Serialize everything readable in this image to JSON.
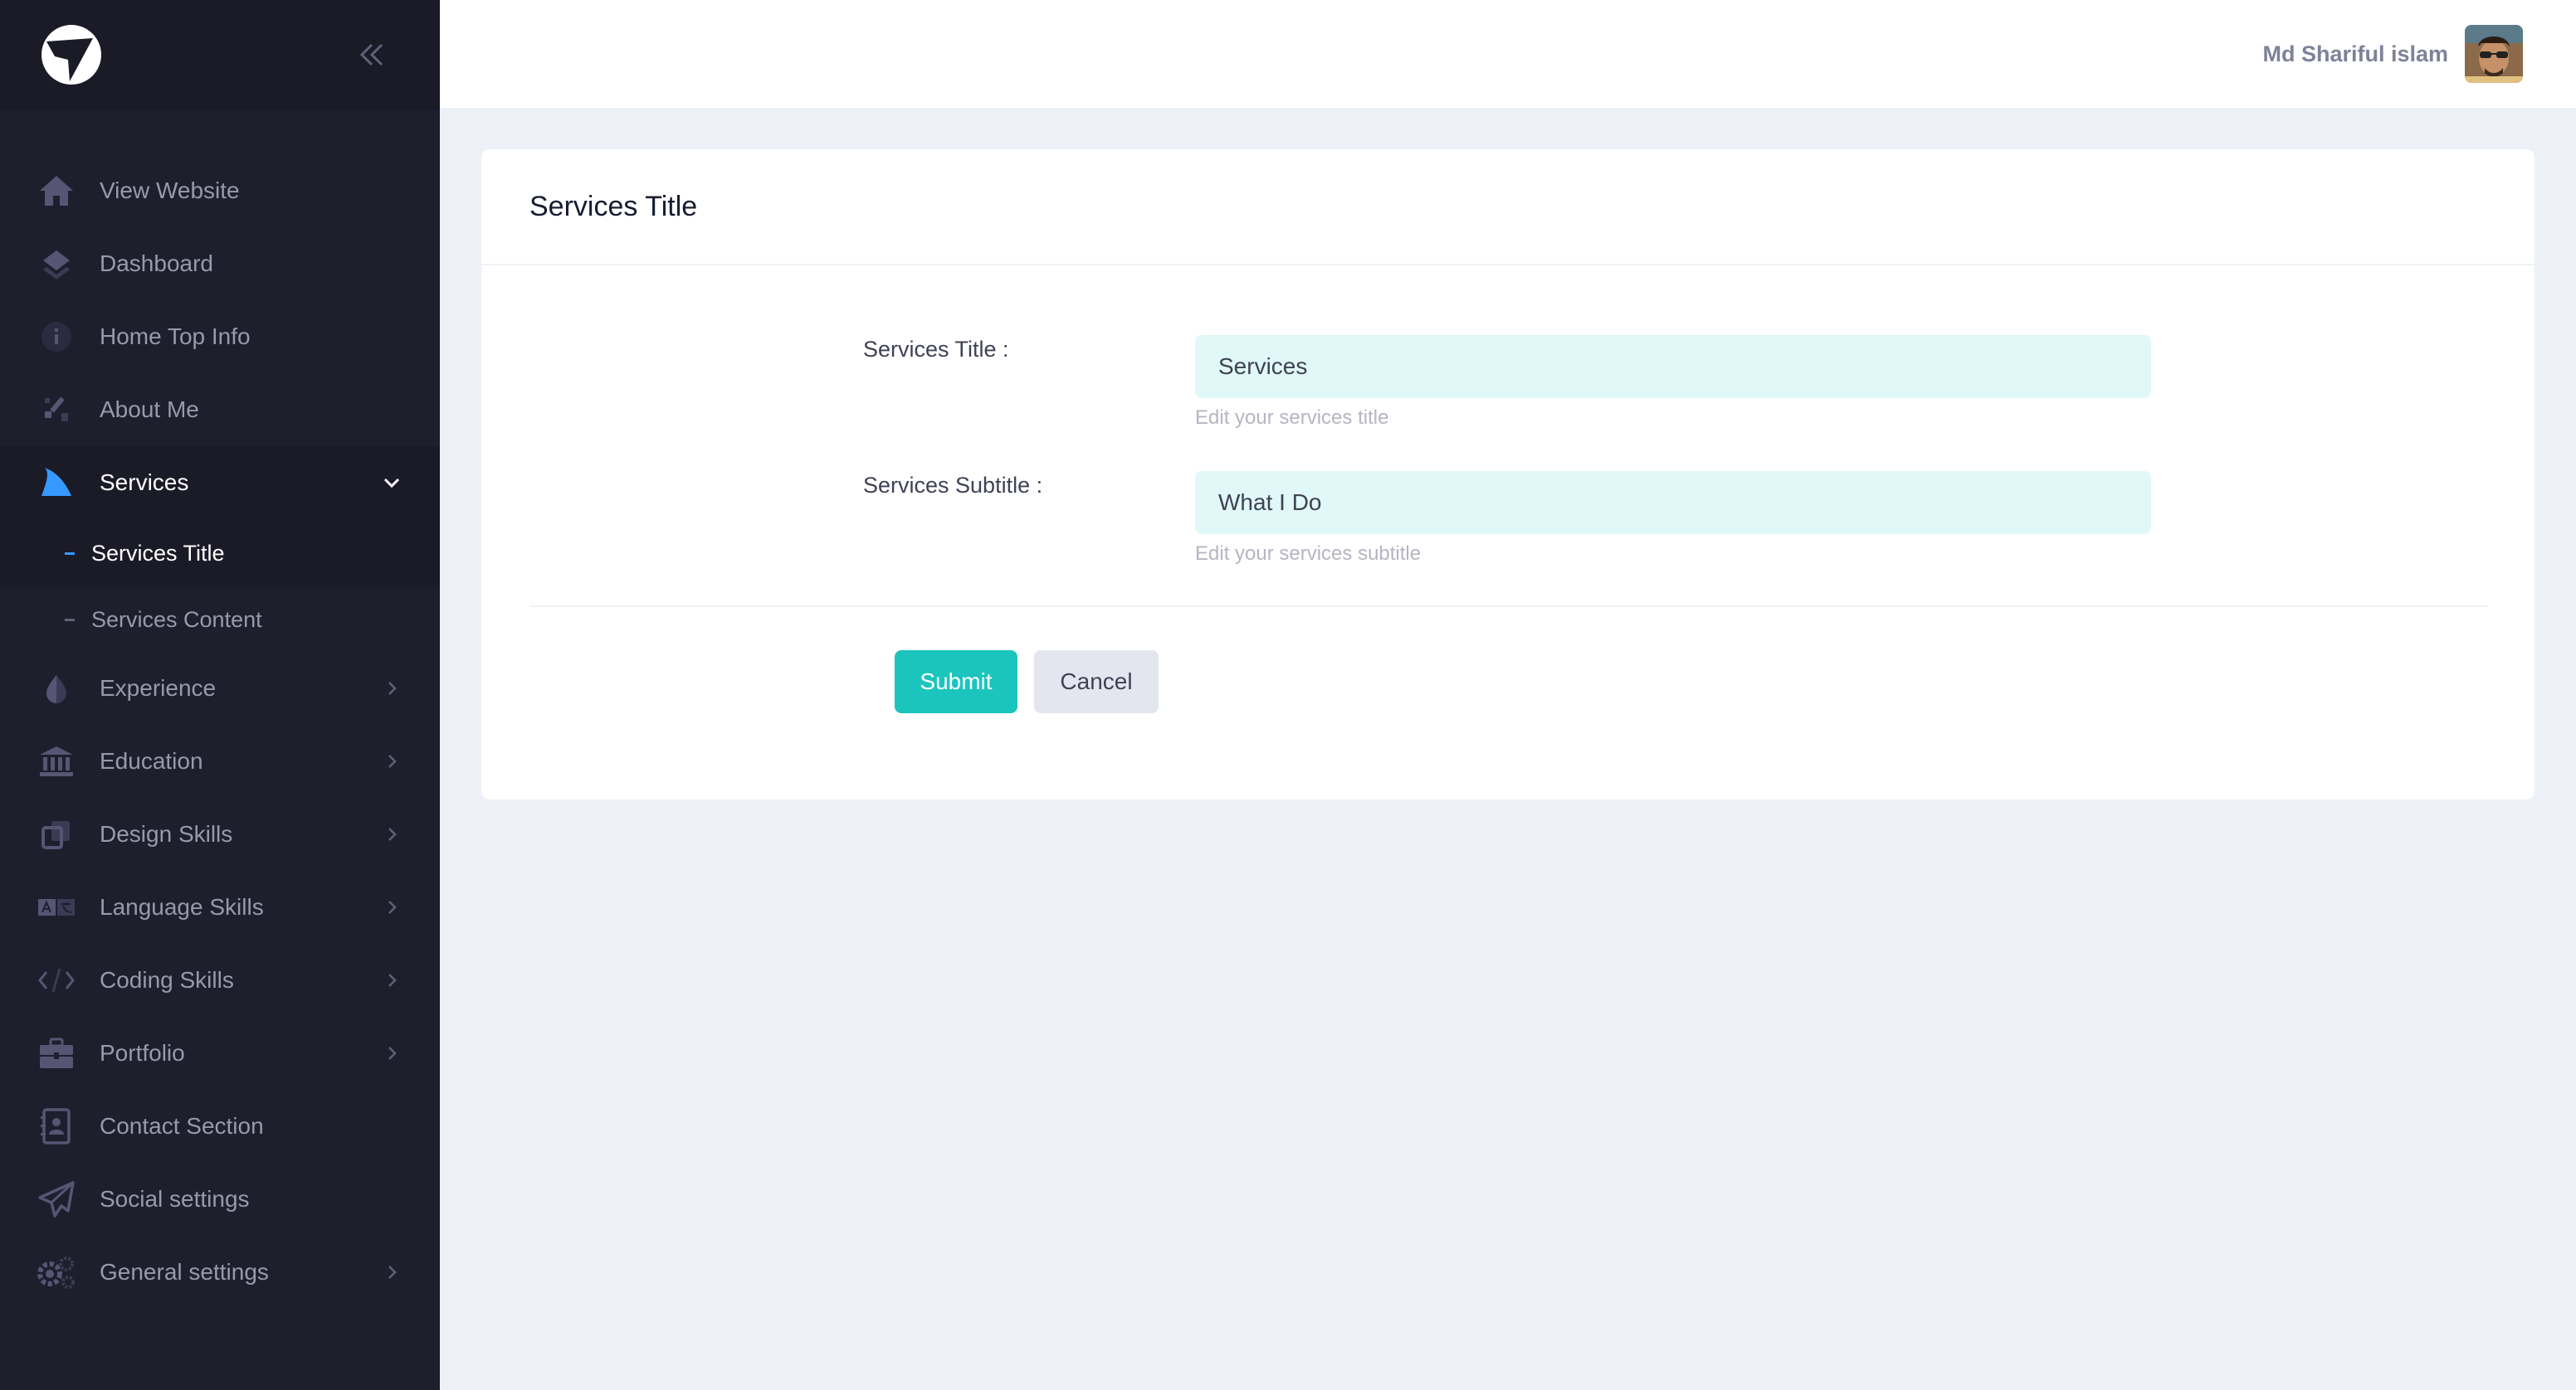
{
  "header": {
    "user_name": "Md Shariful islam"
  },
  "sidebar": {
    "items": [
      {
        "label": "View Website",
        "icon": "home-icon"
      },
      {
        "label": "Dashboard",
        "icon": "layers-icon"
      },
      {
        "label": "Home Top Info",
        "icon": "info-icon"
      },
      {
        "label": "About Me",
        "icon": "tools-icon"
      },
      {
        "label": "Services",
        "icon": "shark-fin-icon",
        "expanded": true
      },
      {
        "label": "Experience",
        "icon": "drop-half-icon"
      },
      {
        "label": "Education",
        "icon": "bank-icon"
      },
      {
        "label": "Design Skills",
        "icon": "copy-icon"
      },
      {
        "label": "Language Skills",
        "icon": "translate-icon"
      },
      {
        "label": "Coding Skills",
        "icon": "code-icon"
      },
      {
        "label": "Portfolio",
        "icon": "briefcase-icon"
      },
      {
        "label": "Contact Section",
        "icon": "contact-book-icon"
      },
      {
        "label": "Social settings",
        "icon": "send-icon"
      },
      {
        "label": "General settings",
        "icon": "gears-icon"
      }
    ],
    "services_sub": [
      {
        "label": "Services Title",
        "active": true
      },
      {
        "label": "Services Content",
        "active": false
      }
    ]
  },
  "card": {
    "title": "Services Title"
  },
  "form": {
    "title_label": "Services Title :",
    "title_value": "Services",
    "title_help": "Edit your services title",
    "subtitle_label": "Services Subtitle :",
    "subtitle_value": "What I Do",
    "subtitle_help": "Edit your services subtitle",
    "submit_label": "Submit",
    "cancel_label": "Cancel"
  },
  "colors": {
    "sidebar_bg": "#1e1e2d",
    "accent_teal": "#1bc5bd",
    "active_blue": "#3699ff",
    "input_bg": "#e0f8f8"
  }
}
